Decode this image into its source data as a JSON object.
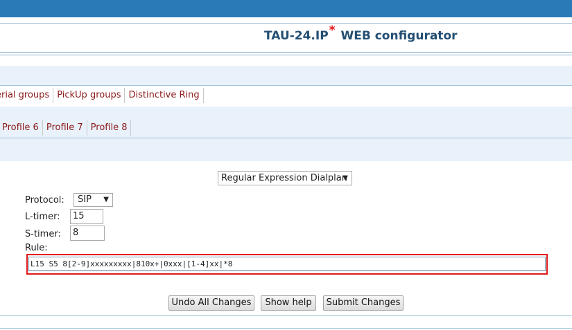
{
  "header": {
    "title": "TAU-24.IP",
    "title_mark": "*",
    "title_suffix": "WEB configurator"
  },
  "tabs_row1": [
    "erial groups",
    "PickUp groups",
    "Distinctive Ring"
  ],
  "tabs_row2": [
    "Profile 6",
    "Profile 7",
    "Profile 8"
  ],
  "form": {
    "dialplan_select": "Regular Expression Dialplan",
    "protocol_label": "Protocol:",
    "protocol_value": "SIP",
    "ltimer_label": "L-timer:",
    "ltimer_value": "15",
    "stimer_label": "S-timer:",
    "stimer_value": "8",
    "rule_label": "Rule:",
    "rule_value": "L15 S5 8[2-9]xxxxxxxxx|810x+|0xxx|[1-4]xx|*8"
  },
  "buttons": {
    "undo": "Undo All Changes",
    "help": "Show help",
    "submit": "Submit Changes"
  },
  "colors": {
    "top_bar": "#2a7ab8",
    "title": "#244f73",
    "tab_text": "#8b1a1a",
    "highlight": "#e01818"
  }
}
